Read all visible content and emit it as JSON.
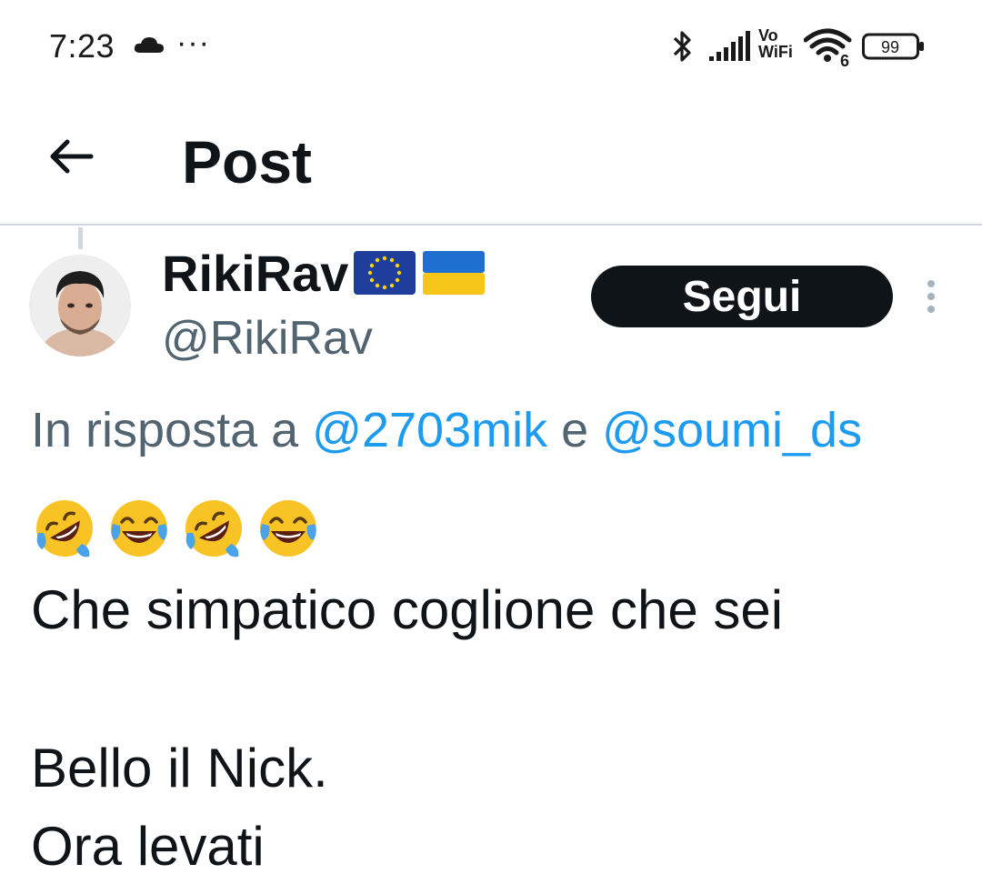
{
  "status_bar": {
    "time": "7:23",
    "dots": "···",
    "vowifi_top": "Vo",
    "vowifi_bottom": "WiFi",
    "wifi_badge": "6",
    "battery": "99",
    "icons": [
      "cloud-icon",
      "bluetooth-icon",
      "signal-icon",
      "wifi-icon",
      "battery-icon"
    ]
  },
  "header": {
    "title": "Post",
    "back_icon": "arrow-left-icon"
  },
  "post": {
    "author": {
      "display_name": "RikiRav",
      "flags": [
        "eu-flag-icon",
        "ukraine-flag-icon"
      ],
      "handle": "@RikiRav"
    },
    "follow_label": "Segui",
    "more_icon": "vertical-dots-icon",
    "reply_context": {
      "prefix": "In risposta a ",
      "mention_1": "@2703mik",
      "joiner": " e ",
      "mention_2": "@soumi_ds"
    },
    "emojis": [
      "rolling-on-floor-laughing-icon",
      "tears-of-joy-icon",
      "rolling-on-floor-laughing-icon",
      "tears-of-joy-icon"
    ],
    "text_lines": [
      "Che simpatico coglione che sei",
      "Bello il Nick.",
      "Ora levati"
    ]
  },
  "colors": {
    "text": "#0f1419",
    "secondary": "#536471",
    "link": "#1d9bf0",
    "divider": "#cfd9de",
    "follow_bg": "#0f1419"
  }
}
